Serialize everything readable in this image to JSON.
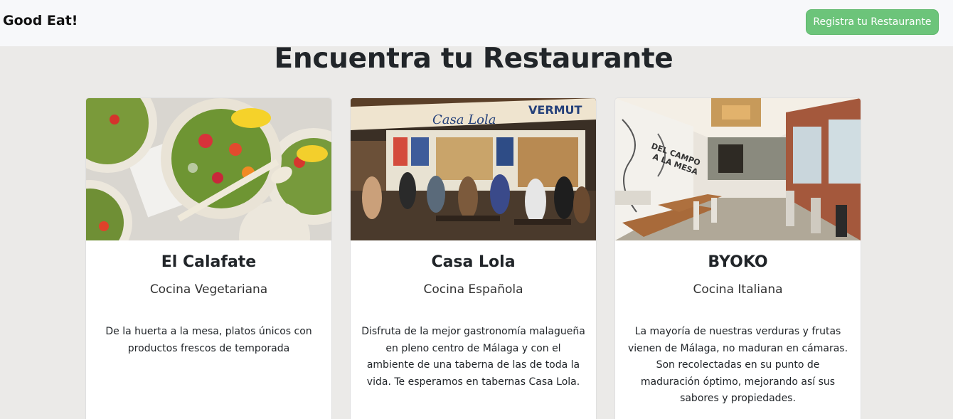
{
  "nav": {
    "brand": "Good Eat!",
    "register_button": "Registra tu Restaurante"
  },
  "main": {
    "title": "Encuentra tu Restaurante"
  },
  "restaurants": [
    {
      "name": "El Calafate",
      "cuisine": "Cocina Vegetariana",
      "description": "De la huerta a la mesa, platos únicos con productos frescos de temporada",
      "image": "salad-bowls-photo"
    },
    {
      "name": "Casa Lola",
      "cuisine": "Cocina Española",
      "description": "Disfruta de la mejor gastronomía malagueña en pleno centro de Málaga y con el ambiente de una taberna de las de toda la vida. Te esperamos en tabernas Casa Lola.",
      "image": "tavern-exterior-photo",
      "sign_texts": [
        "Casa Lola",
        "VERMUT"
      ]
    },
    {
      "name": "BYOKO",
      "cuisine": "Cocina Italiana",
      "description": "La mayoría de nuestras verduras y frutas vienen de Málaga, no maduran en cámaras. Son recolectadas en su punto de maduración óptimo, mejorando así sus sabores y propiedades.",
      "image": "restaurant-interior-photo",
      "mural_text": "DEL CAMPO A LA MESA"
    }
  ],
  "colors": {
    "background": "#ebeae8",
    "navbar": "#f7f8fa",
    "button": "#6cc47a"
  }
}
